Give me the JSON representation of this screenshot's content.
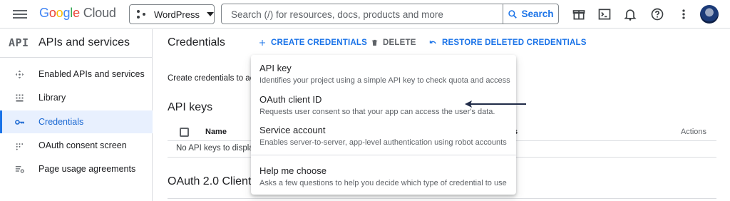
{
  "topbar": {
    "logo_google": "Google",
    "logo_cloud": "Cloud",
    "project_name": "WordPress",
    "search_placeholder": "Search (/) for resources, docs, products and more",
    "search_button": "Search",
    "icons": [
      "gift-icon",
      "terminal-icon",
      "bell-icon",
      "help-icon",
      "more-vert-icon"
    ]
  },
  "sidebar": {
    "badge": "API",
    "title": "APIs and services",
    "items": [
      {
        "label": "Enabled APIs and services",
        "icon": "diamond-arrows-icon"
      },
      {
        "label": "Library",
        "icon": "library-grid-icon"
      },
      {
        "label": "Credentials",
        "icon": "key-icon",
        "active": true
      },
      {
        "label": "OAuth consent screen",
        "icon": "oauth-dots-icon"
      },
      {
        "label": "Page usage agreements",
        "icon": "settings-list-icon"
      }
    ]
  },
  "main": {
    "title": "Credentials",
    "actions": {
      "create": "CREATE CREDENTIALS",
      "delete": "DELETE",
      "restore": "RESTORE DELETED CREDENTIALS"
    },
    "intro": "Create credentials to ac",
    "api_keys_heading": "API keys",
    "table": {
      "name_col": "Name",
      "restrictions_col": "s",
      "actions_col": "Actions"
    },
    "empty_text": "No API keys to displa",
    "oauth_heading": "OAuth 2.0 Client I"
  },
  "menu": {
    "items": [
      {
        "title": "API key",
        "desc": "Identifies your project using a simple API key to check quota and access"
      },
      {
        "title": "OAuth client ID",
        "desc": "Requests user consent so that your app can access the user's data."
      },
      {
        "title": "Service account",
        "desc": "Enables server-to-server, app-level authentication using robot accounts"
      },
      {
        "title": "Help me choose",
        "desc": "Asks a few questions to help you decide which type of credential to use"
      }
    ]
  },
  "colors": {
    "accent": "#1a73e8",
    "active_bg": "#e8f0fe",
    "text": "#202124",
    "muted": "#5f6368"
  }
}
